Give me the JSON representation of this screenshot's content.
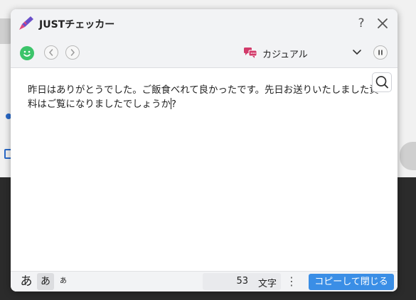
{
  "window": {
    "title": "JUSTチェッカー",
    "help_label": "?",
    "accent_color": "#3a8ee6"
  },
  "toolbar": {
    "status_icon": "smile-icon",
    "prev_icon": "chevron-left-icon",
    "next_icon": "chevron-right-icon",
    "style_select": {
      "selected": "カジュアル",
      "icon": "chat-bubbles-icon"
    },
    "pause_icon": "pause-icon"
  },
  "editor": {
    "text_before_caret": "昨日はありがとうでした。ご飯食べれて良かったです。先日お送りいたしました資料はご覧になりましたでしょうか",
    "text_after_caret": "?",
    "search_icon": "search-icon"
  },
  "footer": {
    "font_sizes": [
      "あ",
      "あ",
      "あ"
    ],
    "selected_font_size": 1,
    "char_count": "53",
    "char_unit": "文字",
    "more_label": "⋮",
    "copy_close_label": "コピーして閉じる"
  }
}
